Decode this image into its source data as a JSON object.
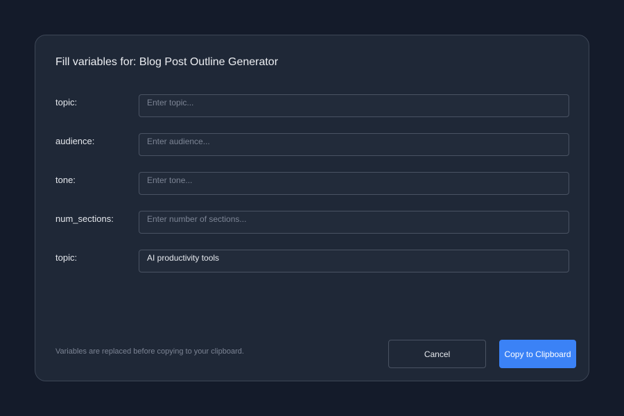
{
  "dialog": {
    "title": "Fill variables for: Blog Post Outline Generator",
    "fields": [
      {
        "label": "topic:",
        "placeholder": "Enter topic...",
        "value": ""
      },
      {
        "label": "audience:",
        "placeholder": "Enter audience...",
        "value": ""
      },
      {
        "label": "tone:",
        "placeholder": "Enter tone...",
        "value": ""
      },
      {
        "label": "num_sections:",
        "placeholder": "Enter number of sections...",
        "value": ""
      },
      {
        "label": "topic:",
        "placeholder": "",
        "value": "AI productivity tools"
      }
    ],
    "footer_note": "Variables are replaced before copying to your clipboard.",
    "cancel_label": "Cancel",
    "copy_label": "Copy to Clipboard"
  },
  "colors": {
    "background": "#141b2a",
    "dialog": "#1f2837",
    "accent": "#3b82f6"
  }
}
